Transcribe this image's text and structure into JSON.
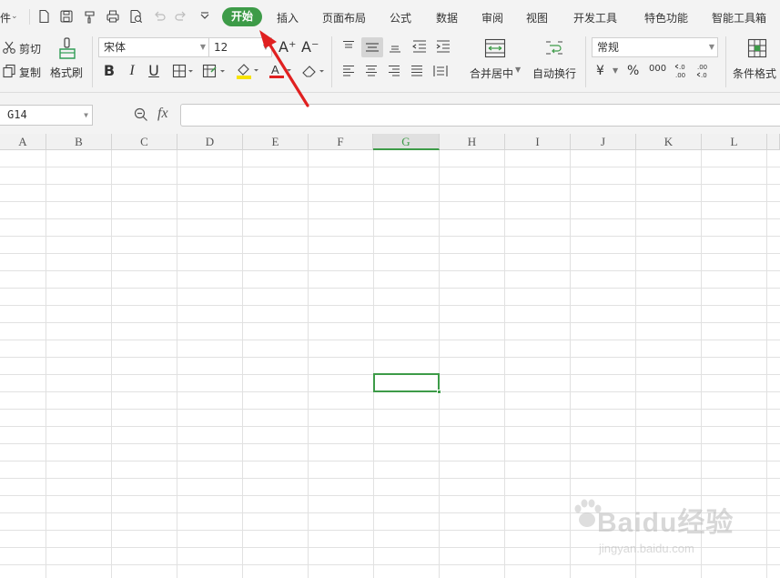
{
  "menubar": {
    "file_partial": "件",
    "tabs": [
      {
        "label": "开始",
        "active": true
      },
      {
        "label": "插入"
      },
      {
        "label": "页面布局"
      },
      {
        "label": "公式"
      },
      {
        "label": "数据"
      },
      {
        "label": "审阅"
      },
      {
        "label": "视图"
      },
      {
        "label": "开发工具"
      },
      {
        "label": "特色功能"
      },
      {
        "label": "智能工具箱"
      }
    ]
  },
  "quick_access": [
    "new-doc-icon",
    "save-icon",
    "format-painter-icon",
    "print-icon",
    "print-preview-icon",
    "undo-icon",
    "redo-icon",
    "more-icon"
  ],
  "ribbon": {
    "cut_label": "剪切",
    "copy_label": "复制",
    "format_painter_label": "格式刷",
    "font_name": "宋体",
    "font_size": "12",
    "font_grow": "A⁺",
    "font_shrink": "A⁻",
    "bold": "B",
    "italic": "I",
    "underline": "U",
    "merge_label": "合并居中",
    "wrap_label": "自动换行",
    "number_format": "常规",
    "currency_symbol": "¥",
    "percent_symbol": "%",
    "thousands_symbol": "000",
    "cond_format_label": "条件格式"
  },
  "formula_bar": {
    "name_box": "G14",
    "fx_label": "fx",
    "formula_value": ""
  },
  "sheet": {
    "columns": [
      "A",
      "B",
      "C",
      "D",
      "E",
      "F",
      "G",
      "H",
      "I",
      "J",
      "K",
      "L"
    ],
    "active_column": "G",
    "active_cell": "G14"
  },
  "colors": {
    "accent": "#3d9b48",
    "annotation": "#e02020"
  },
  "watermark": {
    "brand": "Baidu经验",
    "url": "jingyan.baidu.com"
  }
}
